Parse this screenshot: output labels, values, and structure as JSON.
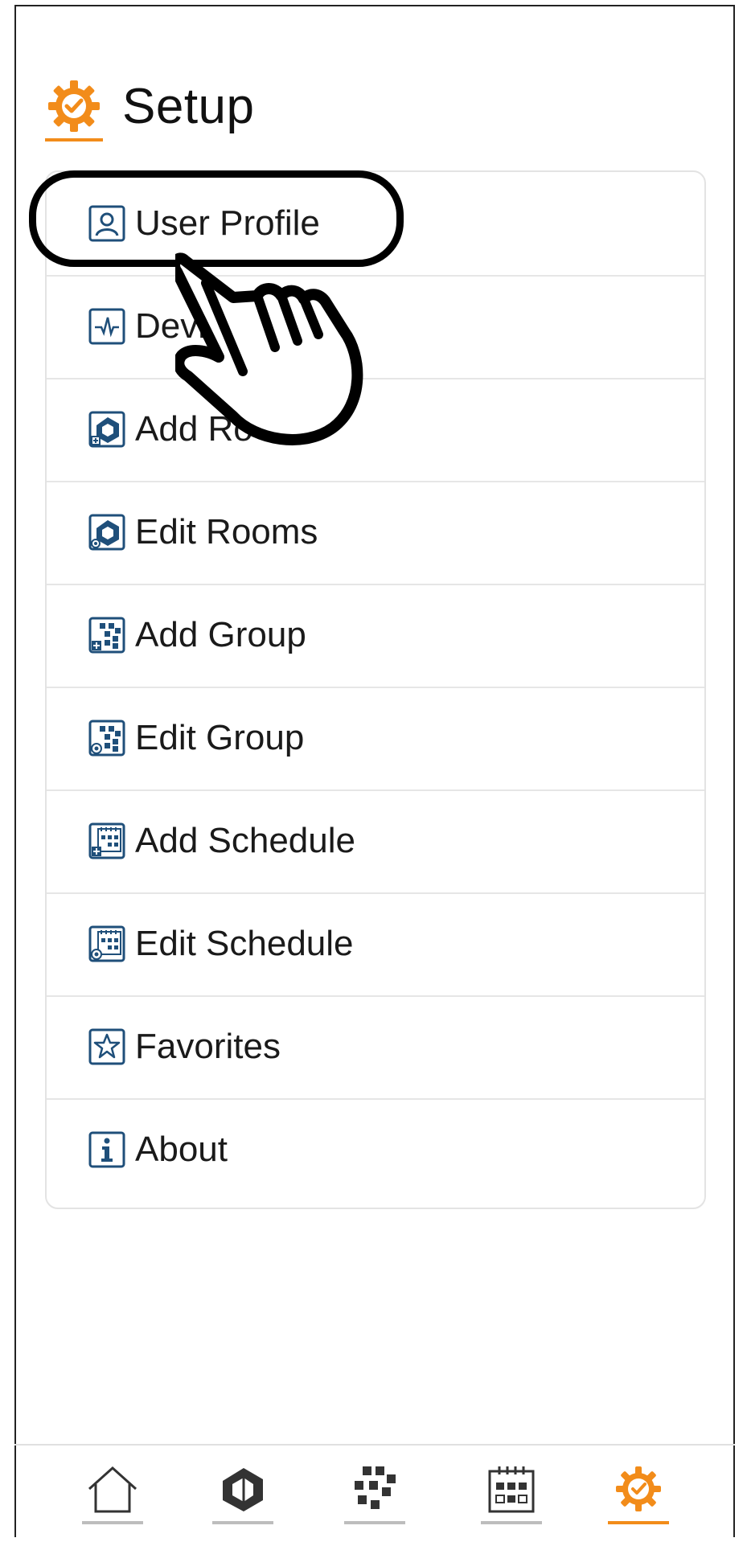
{
  "header": {
    "title": "Setup",
    "icon": "gear-check-icon"
  },
  "menu": {
    "items": [
      {
        "label": "User Profile",
        "icon": "user-profile-icon"
      },
      {
        "label": "Devi",
        "icon": "device-pulse-icon"
      },
      {
        "label": "Add Ro",
        "icon": "add-room-icon"
      },
      {
        "label": "Edit Rooms",
        "icon": "edit-rooms-icon"
      },
      {
        "label": "Add Group",
        "icon": "add-group-icon"
      },
      {
        "label": "Edit Group",
        "icon": "edit-group-icon"
      },
      {
        "label": "Add Schedule",
        "icon": "add-schedule-icon"
      },
      {
        "label": "Edit Schedule",
        "icon": "edit-schedule-icon"
      },
      {
        "label": "Favorites",
        "icon": "star-icon"
      },
      {
        "label": "About",
        "icon": "info-icon"
      }
    ]
  },
  "tabs": [
    {
      "name": "home-icon",
      "active": false
    },
    {
      "name": "rooms-icon",
      "active": false
    },
    {
      "name": "groups-icon",
      "active": false
    },
    {
      "name": "schedule-icon",
      "active": false
    },
    {
      "name": "setup-gear-icon",
      "active": true
    }
  ],
  "colors": {
    "accent": "#f28c1a",
    "icon_blue": "#1f4f7a",
    "divider": "#e6e6e6"
  }
}
